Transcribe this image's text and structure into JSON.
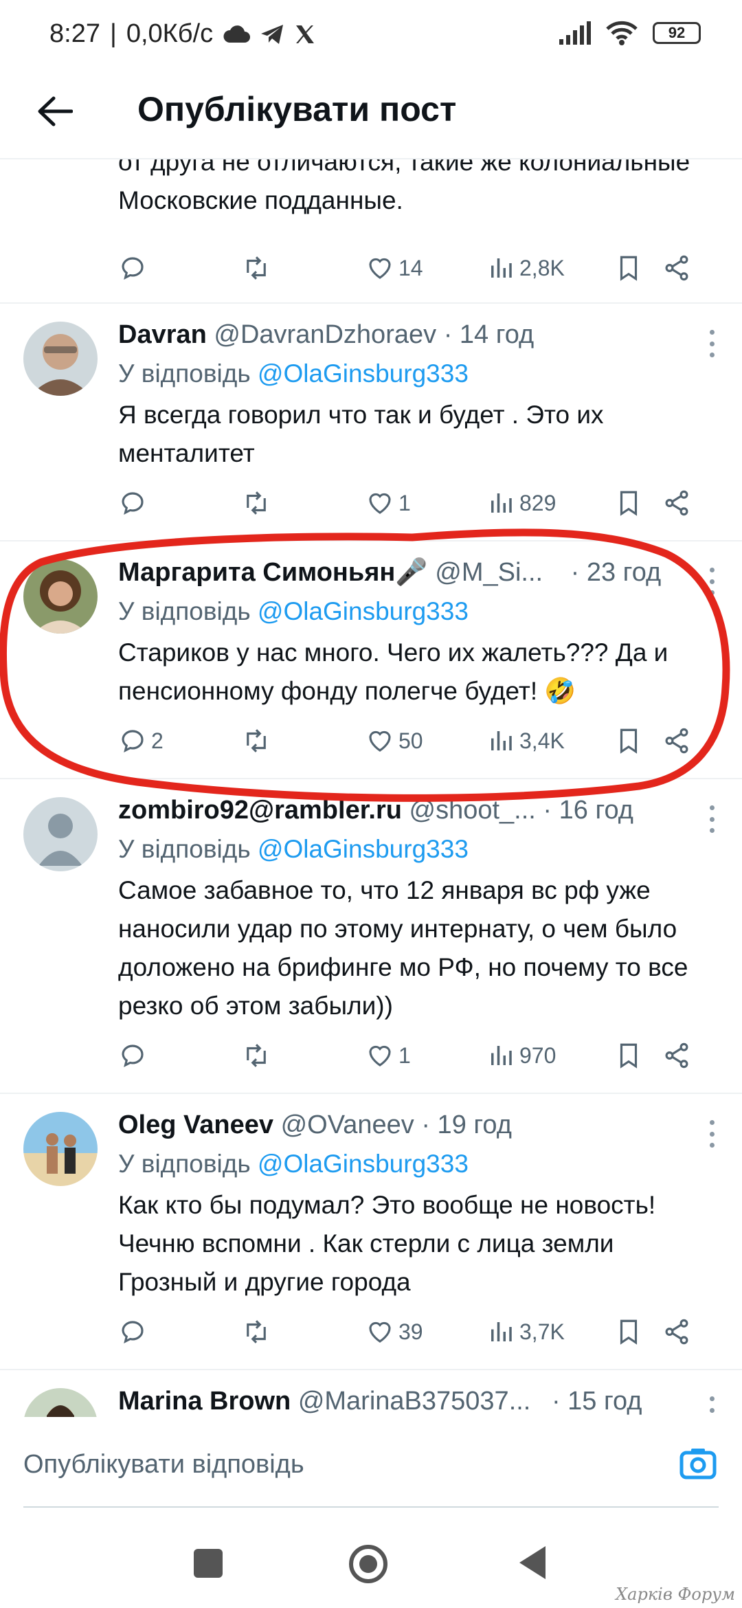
{
  "status_bar": {
    "time": "8:27",
    "speed": "0,0Кб/с",
    "battery": "92"
  },
  "header": {
    "title": "Опублікувати пост"
  },
  "feed": {
    "partial_post": {
      "text": "от друга не отличаются, такие же колониальные Московские подданные.",
      "replies": "",
      "likes": "14",
      "views": "2,8K"
    },
    "posts": [
      {
        "name": "Davran",
        "handle": "@DavranDzhoraev",
        "time": "· 14 год",
        "reply_prefix": "У відповідь",
        "reply_to": "@OlaGinsburg333",
        "text": "Я всегда говорил что так и будет . Это их менталитет",
        "replies": "",
        "likes": "1",
        "views": "829"
      },
      {
        "name": "Маргарита Симоньян🎤",
        "handle": "@M_Si...",
        "time": "· 23 год",
        "reply_prefix": "У відповідь",
        "reply_to": "@OlaGinsburg333",
        "text": "Стариков у нас много. Чего их жалеть??? Да и пенсионному фонду полегче будет! 🤣",
        "replies": "2",
        "likes": "50",
        "views": "3,4K"
      },
      {
        "name": "zombiro92@rambler.ru",
        "handle": "@shoot_...",
        "time": "· 16 год",
        "reply_prefix": "У відповідь",
        "reply_to": "@OlaGinsburg333",
        "text": "Самое забавное то, что 12 января вс рф уже наносили удар по этому интернату, о чем было доложено на брифинге мо РФ, но почему то все резко об этом забыли))",
        "replies": "",
        "likes": "1",
        "views": "970"
      },
      {
        "name": "Oleg Vaneev",
        "handle": "@OVaneev",
        "time": "· 19 год",
        "reply_prefix": "У відповідь",
        "reply_to": "@OlaGinsburg333",
        "text": "Как кто бы подумал? Это вообще не новость! Чечню вспомни . Как стерли с лица земли Грозный и другие города",
        "replies": "",
        "likes": "39",
        "views": "3,7K"
      },
      {
        "name": "Marina Brown",
        "handle": "@MarinaB375037...",
        "time": "· 15 год"
      }
    ]
  },
  "compose": {
    "placeholder": "Опублікувати відповідь"
  },
  "watermark": "Харків Форум",
  "colors": {
    "accent": "#1d9bf0",
    "secondary_text": "#536471",
    "highlight": "#e3261c"
  }
}
